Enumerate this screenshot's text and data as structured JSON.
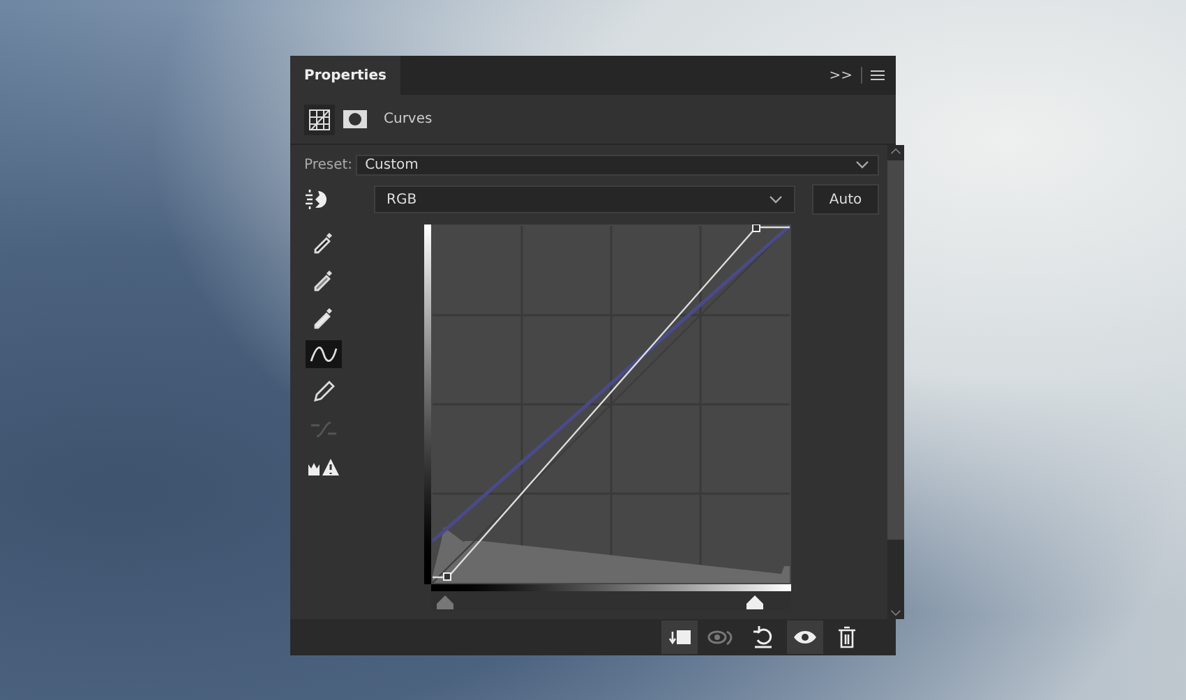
{
  "panel": {
    "title": "Properties",
    "collapse": ">>"
  },
  "adjustment": {
    "label": "Curves"
  },
  "preset": {
    "label": "Preset:",
    "value": "Custom"
  },
  "channel": {
    "value": "RGB"
  },
  "auto_button": "Auto",
  "input_sliders": [
    {
      "level": 0.04
    },
    {
      "level": 0.9
    }
  ],
  "tools": [
    {
      "kind": "eyedropper-dark",
      "selected": false,
      "disabled": false
    },
    {
      "kind": "eyedropper-gray",
      "selected": false,
      "disabled": false
    },
    {
      "kind": "eyedropper-light",
      "selected": false,
      "disabled": false
    },
    {
      "kind": "curve",
      "selected": true,
      "disabled": false
    },
    {
      "kind": "pencil",
      "selected": false,
      "disabled": false
    },
    {
      "kind": "smooth",
      "selected": false,
      "disabled": true
    },
    {
      "kind": "clipping",
      "selected": false,
      "disabled": false
    }
  ],
  "footer_buttons": [
    {
      "kind": "clip",
      "selected": true,
      "disabled": false
    },
    {
      "kind": "previous",
      "selected": false,
      "disabled": true
    },
    {
      "kind": "reset",
      "selected": false,
      "disabled": false
    },
    {
      "kind": "visibility",
      "selected": true,
      "disabled": false
    },
    {
      "kind": "delete",
      "selected": false,
      "disabled": false
    }
  ]
}
